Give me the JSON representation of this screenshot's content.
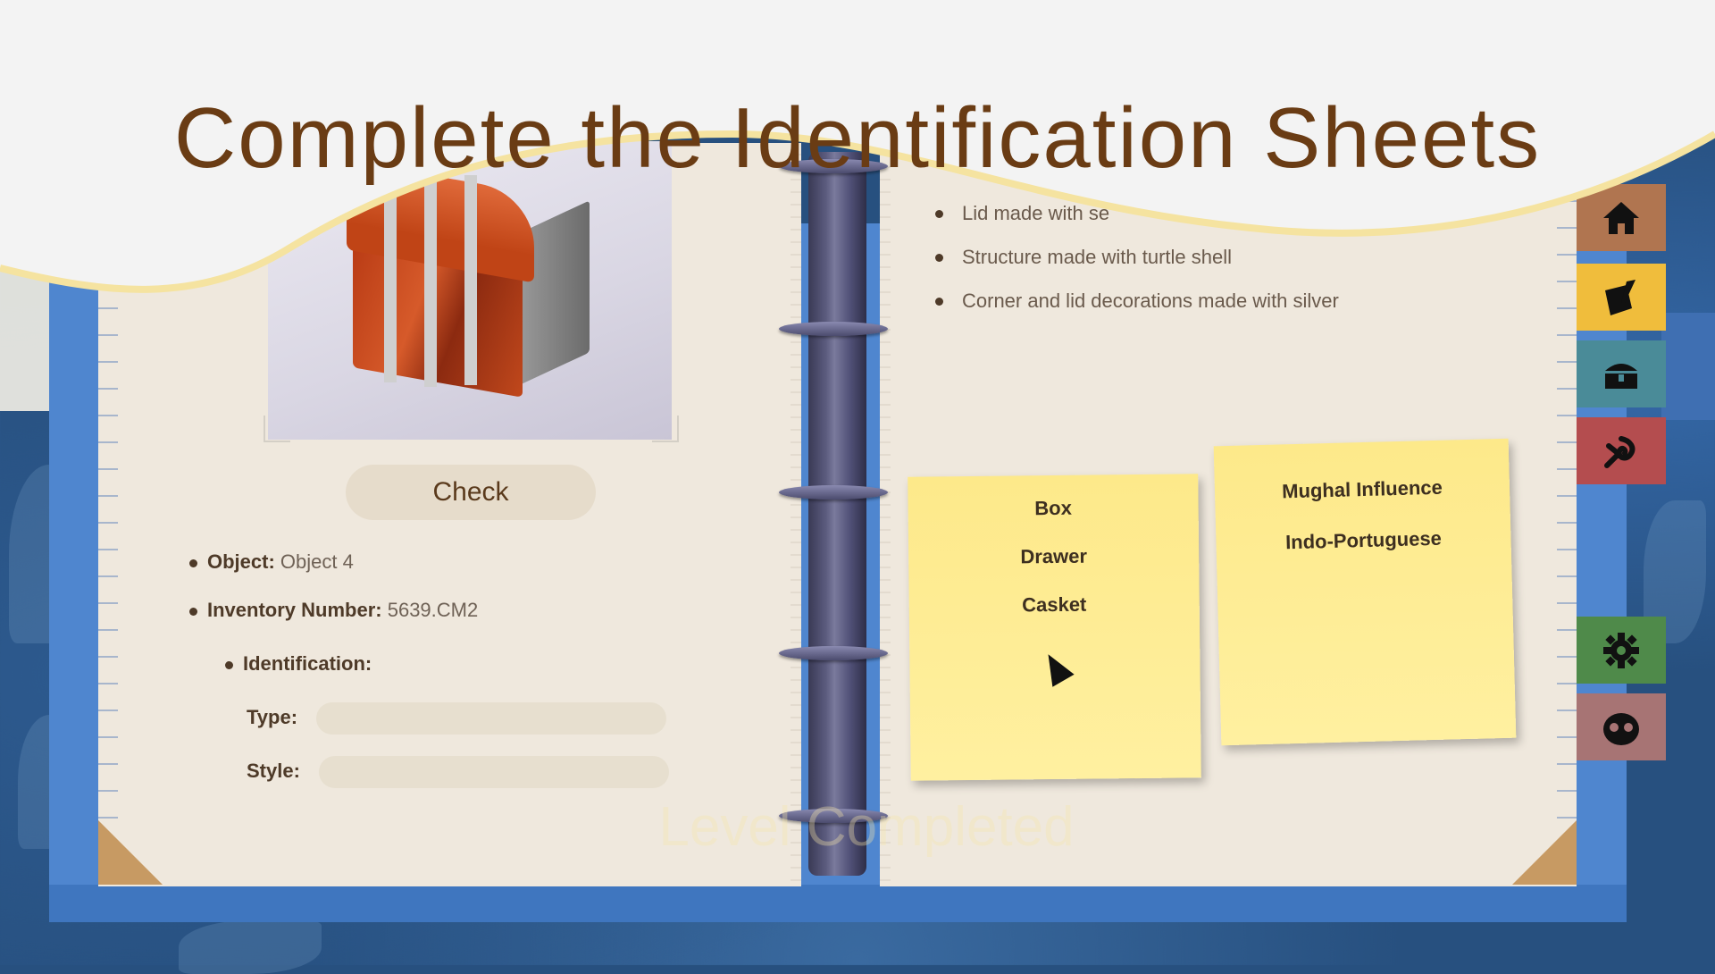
{
  "title": "Complete the Identification Sheets",
  "check_label": "Check",
  "object": {
    "label": "Object:",
    "value": "Object 4"
  },
  "inventory": {
    "label": "Inventory Number:",
    "value": "5639.CM2"
  },
  "identification_label": "Identification:",
  "type_label": "Type:",
  "style_label": "Style:",
  "description": [
    "Lid made with se",
    "Structure made with turtle shell",
    "Corner and lid decorations made with silver"
  ],
  "sticky_type_options": [
    "Box",
    "Drawer",
    "Casket"
  ],
  "sticky_style_options": [
    "Mughal Influence",
    "Indo-Portuguese"
  ],
  "level_completed": "Level Completed",
  "side_tabs": [
    "home-icon",
    "edit-note-icon",
    "chest-icon",
    "creature-icon",
    "gear-icon",
    "profile-face-icon"
  ],
  "colors": {
    "title": "#6a3c14",
    "binder": "#4f86cf",
    "page": "#efe8dd",
    "sticky": "#fde98a",
    "tab_home": "#b07550",
    "tab_edit": "#f0bd3c",
    "tab_chest": "#4a8b98",
    "tab_creature": "#b44d4f",
    "tab_settings": "#4f8a4a",
    "tab_profile": "#a77474"
  }
}
